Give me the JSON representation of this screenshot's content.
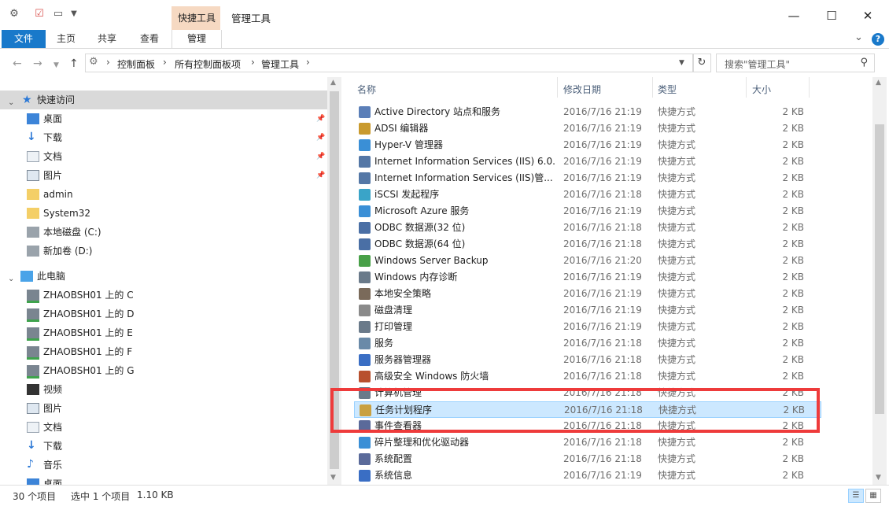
{
  "titlebar": {
    "context_tab_label": "快捷工具",
    "window_title": "管理工具",
    "minimize": "—",
    "maximize": "☐",
    "close": "✕"
  },
  "ribbon": {
    "file": "文件",
    "home": "主页",
    "share": "共享",
    "view": "查看",
    "manage": "管理",
    "expand": "⌄",
    "help": "?"
  },
  "address": {
    "crumbs": [
      "控制面板",
      "所有控制面板项",
      "管理工具"
    ],
    "search_placeholder": "搜索\"管理工具\""
  },
  "nav": {
    "quick_access": "快速访问",
    "quick_items": [
      {
        "label": "桌面",
        "icon": "desktop-icon",
        "pinned": true
      },
      {
        "label": "下载",
        "icon": "download-icon",
        "pinned": true
      },
      {
        "label": "文档",
        "icon": "document-icon",
        "pinned": true
      },
      {
        "label": "图片",
        "icon": "picture-icon",
        "pinned": true
      },
      {
        "label": "admin",
        "icon": "folder-icon"
      },
      {
        "label": "System32",
        "icon": "folder-icon"
      },
      {
        "label": "本地磁盘 (C:)",
        "icon": "drive-icon"
      },
      {
        "label": "新加卷 (D:)",
        "icon": "drive-icon"
      }
    ],
    "this_pc": "此电脑",
    "pc_items": [
      {
        "label": "ZHAOBSH01 上的 C",
        "icon": "network-drive-icon"
      },
      {
        "label": "ZHAOBSH01 上的 D",
        "icon": "network-drive-icon"
      },
      {
        "label": "ZHAOBSH01 上的 E",
        "icon": "network-drive-icon"
      },
      {
        "label": "ZHAOBSH01 上的 F",
        "icon": "network-drive-icon"
      },
      {
        "label": "ZHAOBSH01 上的 G",
        "icon": "network-drive-icon"
      },
      {
        "label": "视频",
        "icon": "video-icon"
      },
      {
        "label": "图片",
        "icon": "picture-icon"
      },
      {
        "label": "文档",
        "icon": "document-icon"
      },
      {
        "label": "下载",
        "icon": "download-icon"
      },
      {
        "label": "音乐",
        "icon": "music-icon"
      },
      {
        "label": "桌面",
        "icon": "desktop-icon"
      }
    ]
  },
  "columns": {
    "name": "名称",
    "date": "修改日期",
    "type": "类型",
    "size": "大小"
  },
  "files": [
    {
      "name": "Active Directory 站点和服务",
      "date": "2016/7/16 21:19",
      "type": "快捷方式",
      "size": "2 KB"
    },
    {
      "name": "ADSI 编辑器",
      "date": "2016/7/16 21:19",
      "type": "快捷方式",
      "size": "2 KB"
    },
    {
      "name": "Hyper-V 管理器",
      "date": "2016/7/16 21:19",
      "type": "快捷方式",
      "size": "2 KB"
    },
    {
      "name": "Internet Information Services (IIS) 6.0...",
      "date": "2016/7/16 21:19",
      "type": "快捷方式",
      "size": "2 KB"
    },
    {
      "name": "Internet Information Services (IIS)管...",
      "date": "2016/7/16 21:19",
      "type": "快捷方式",
      "size": "2 KB"
    },
    {
      "name": "iSCSI 发起程序",
      "date": "2016/7/16 21:18",
      "type": "快捷方式",
      "size": "2 KB"
    },
    {
      "name": "Microsoft Azure 服务",
      "date": "2016/7/16 21:19",
      "type": "快捷方式",
      "size": "2 KB"
    },
    {
      "name": "ODBC 数据源(32 位)",
      "date": "2016/7/16 21:18",
      "type": "快捷方式",
      "size": "2 KB"
    },
    {
      "name": "ODBC 数据源(64 位)",
      "date": "2016/7/16 21:18",
      "type": "快捷方式",
      "size": "2 KB"
    },
    {
      "name": "Windows Server Backup",
      "date": "2016/7/16 21:20",
      "type": "快捷方式",
      "size": "2 KB"
    },
    {
      "name": "Windows 内存诊断",
      "date": "2016/7/16 21:19",
      "type": "快捷方式",
      "size": "2 KB"
    },
    {
      "name": "本地安全策略",
      "date": "2016/7/16 21:19",
      "type": "快捷方式",
      "size": "2 KB"
    },
    {
      "name": "磁盘清理",
      "date": "2016/7/16 21:19",
      "type": "快捷方式",
      "size": "2 KB"
    },
    {
      "name": "打印管理",
      "date": "2016/7/16 21:19",
      "type": "快捷方式",
      "size": "2 KB"
    },
    {
      "name": "服务",
      "date": "2016/7/16 21:18",
      "type": "快捷方式",
      "size": "2 KB"
    },
    {
      "name": "服务器管理器",
      "date": "2016/7/16 21:18",
      "type": "快捷方式",
      "size": "2 KB"
    },
    {
      "name": "高级安全 Windows 防火墙",
      "date": "2016/7/16 21:18",
      "type": "快捷方式",
      "size": "2 KB"
    },
    {
      "name": "计算机管理",
      "date": "2016/7/16 21:18",
      "type": "快捷方式",
      "size": "2 KB"
    },
    {
      "name": "任务计划程序",
      "date": "2016/7/16 21:18",
      "type": "快捷方式",
      "size": "2 KB",
      "selected": true
    },
    {
      "name": "事件查看器",
      "date": "2016/7/16 21:18",
      "type": "快捷方式",
      "size": "2 KB"
    },
    {
      "name": "碎片整理和优化驱动器",
      "date": "2016/7/16 21:18",
      "type": "快捷方式",
      "size": "2 KB"
    },
    {
      "name": "系统配置",
      "date": "2016/7/16 21:18",
      "type": "快捷方式",
      "size": "2 KB"
    },
    {
      "name": "系统信息",
      "date": "2016/7/16 21:19",
      "type": "快捷方式",
      "size": "2 KB"
    }
  ],
  "status": {
    "count": "30 个项目",
    "selection": "选中 1 个项目",
    "selection_size": "1.10 KB"
  },
  "colors": {
    "accent": "#1979ca",
    "selection": "#cce8ff",
    "highlight_box": "#ee3b3b"
  }
}
